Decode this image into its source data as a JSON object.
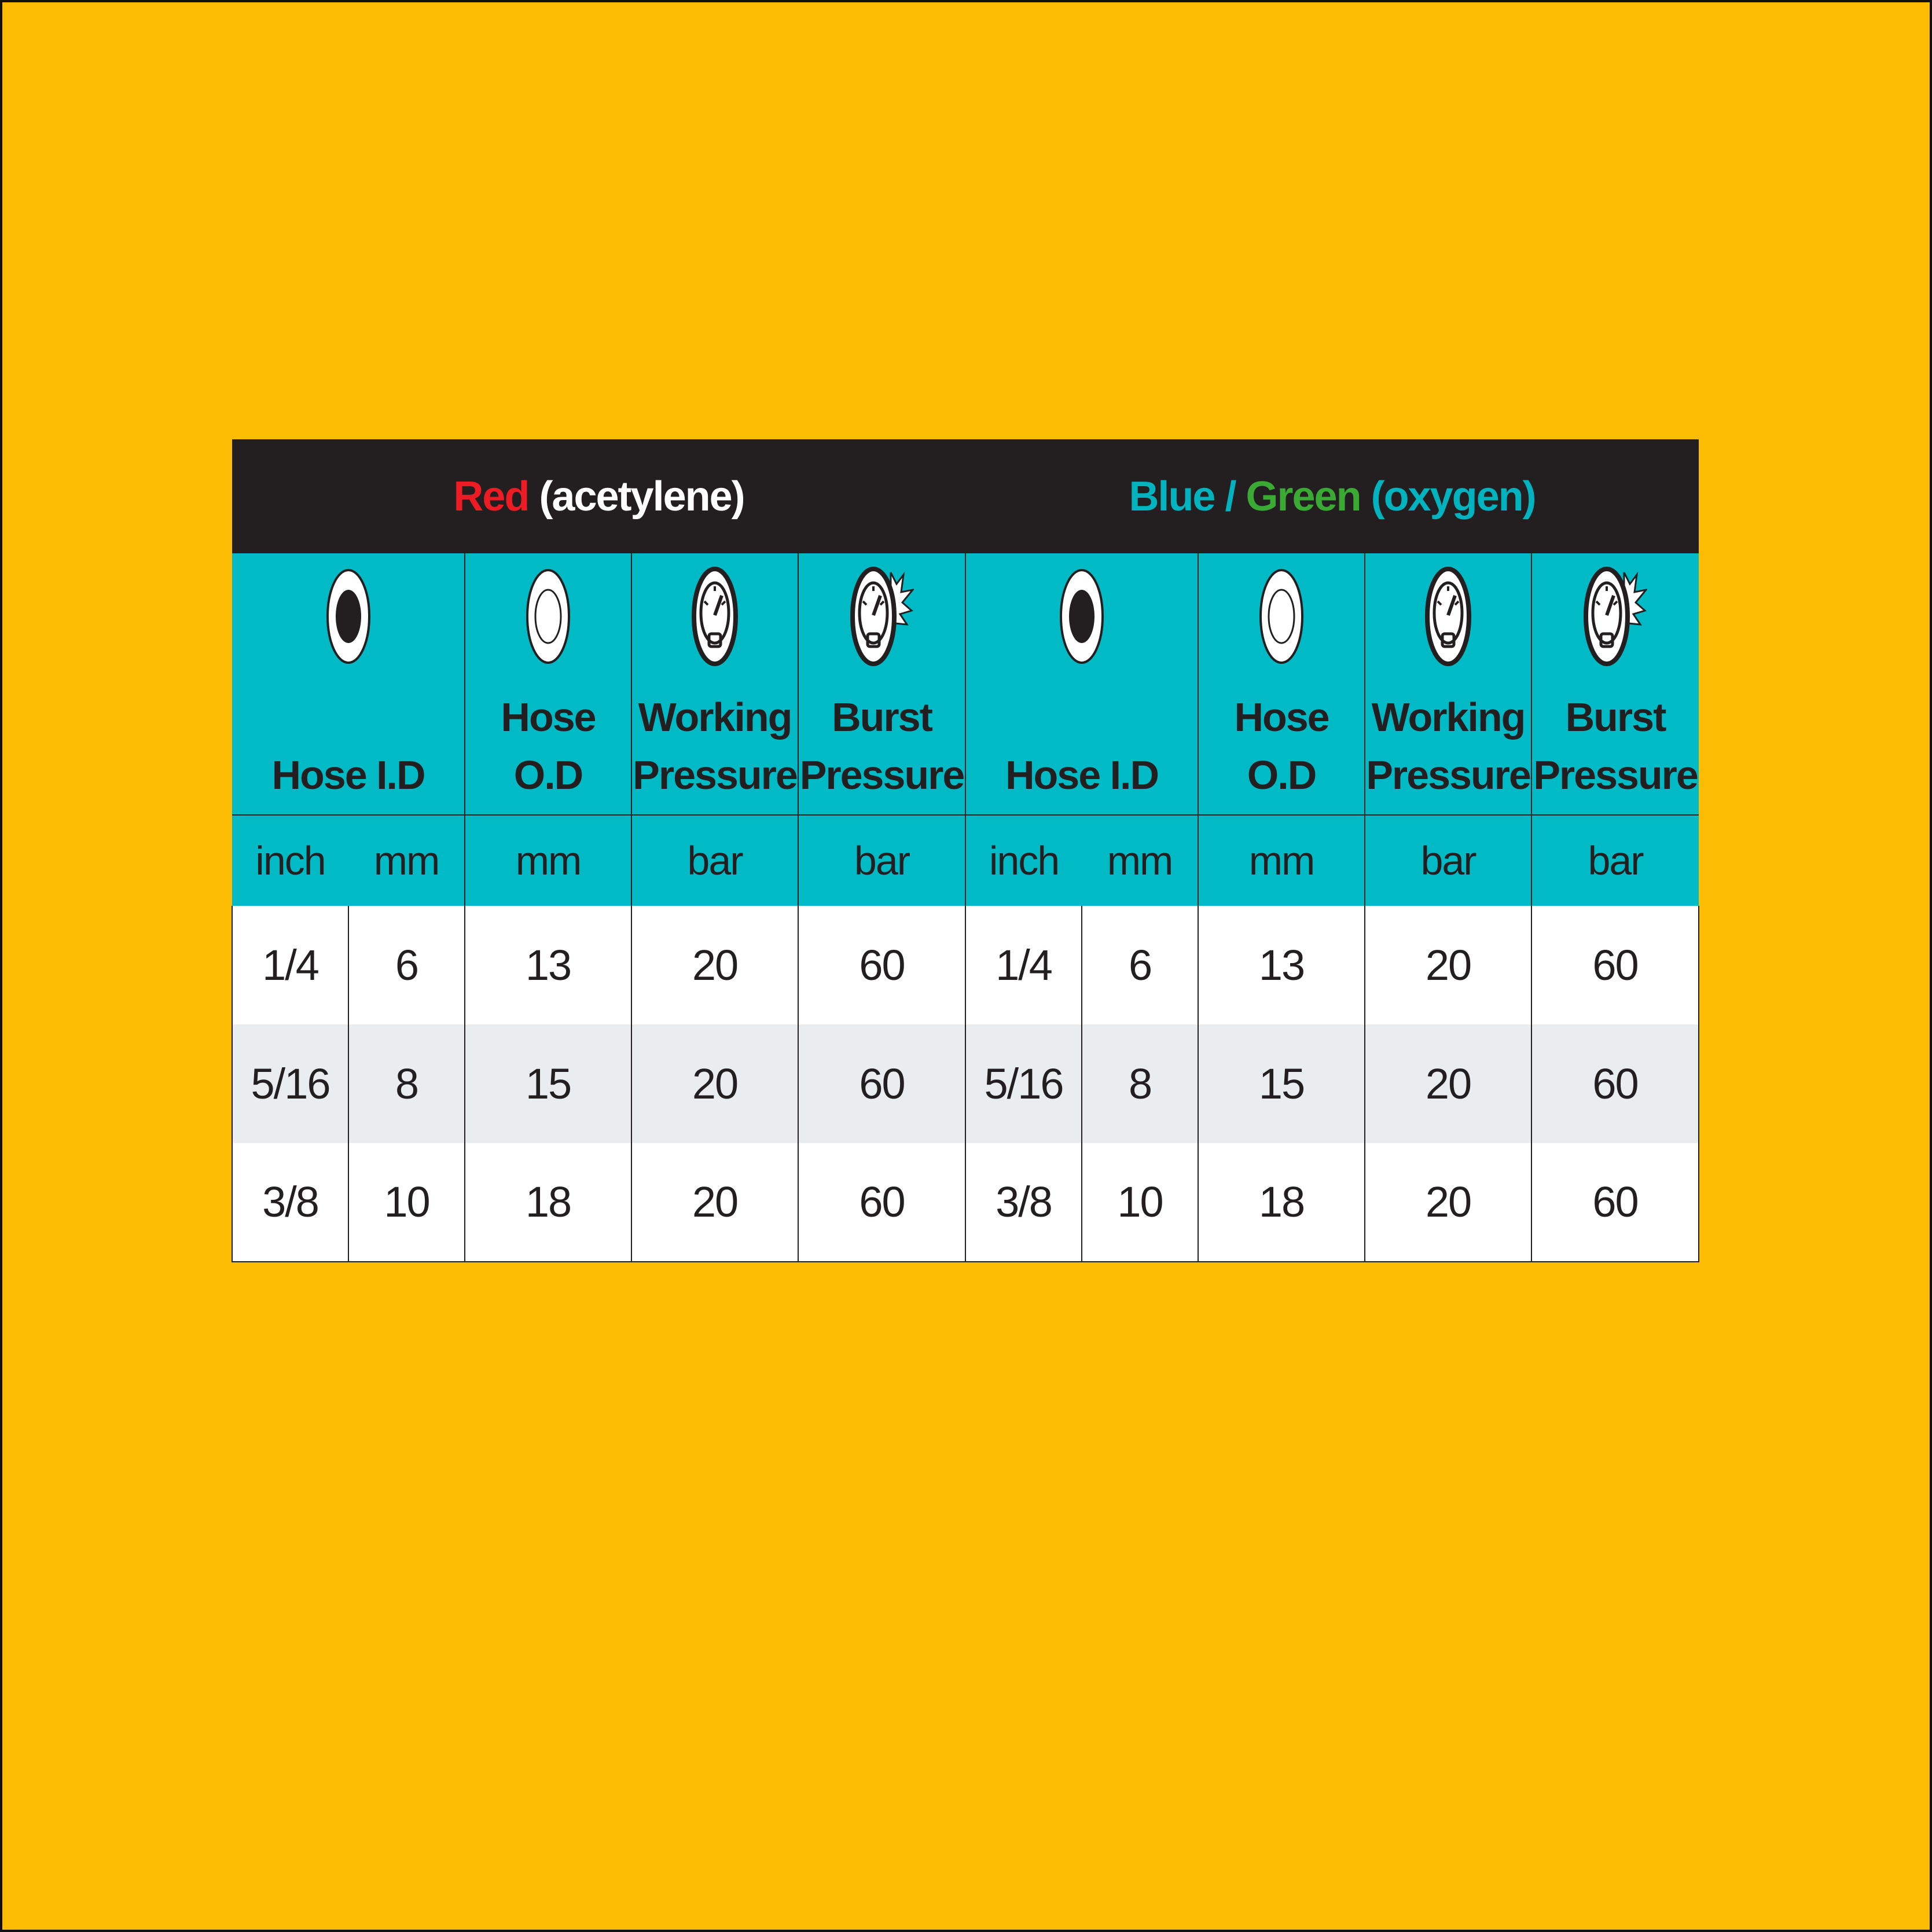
{
  "headers": {
    "red_group": {
      "color_word": "Red",
      "gas": "(acetylene)"
    },
    "blue_green_group": {
      "color_word_1": "Blue",
      "separator": " / ",
      "color_word_2": "Green",
      "gas": "(oxygen)"
    }
  },
  "colors": {
    "background": "#FBBC03",
    "header_bg": "#231F20",
    "teal": "#00BAC6",
    "red": "#ED1C24",
    "blue": "#00B3BE",
    "green": "#3AAA35",
    "zebra": "#E9EDF0"
  },
  "columns": {
    "hose_id": "Hose I.D",
    "hose_od": "Hose O.D",
    "working_pressure_line1": "Working",
    "working_pressure_line2": "Pressure",
    "burst_pressure_line1": "Burst",
    "burst_pressure_line2": "Pressure"
  },
  "icons": {
    "hose_id": "hose-inner-diameter-icon",
    "hose_od": "hose-outer-diameter-icon",
    "working_pressure": "pressure-gauge-icon",
    "burst_pressure": "burst-gauge-icon"
  },
  "units": {
    "inch": "inch",
    "mm": "mm",
    "bar": "bar"
  },
  "rows": [
    {
      "inch": "1/4",
      "id_mm": "6",
      "od_mm": "13",
      "working_bar": "20",
      "burst_bar": "60"
    },
    {
      "inch": "5/16",
      "id_mm": "8",
      "od_mm": "15",
      "working_bar": "20",
      "burst_bar": "60"
    },
    {
      "inch": "3/8",
      "id_mm": "10",
      "od_mm": "18",
      "working_bar": "20",
      "burst_bar": "60"
    }
  ]
}
